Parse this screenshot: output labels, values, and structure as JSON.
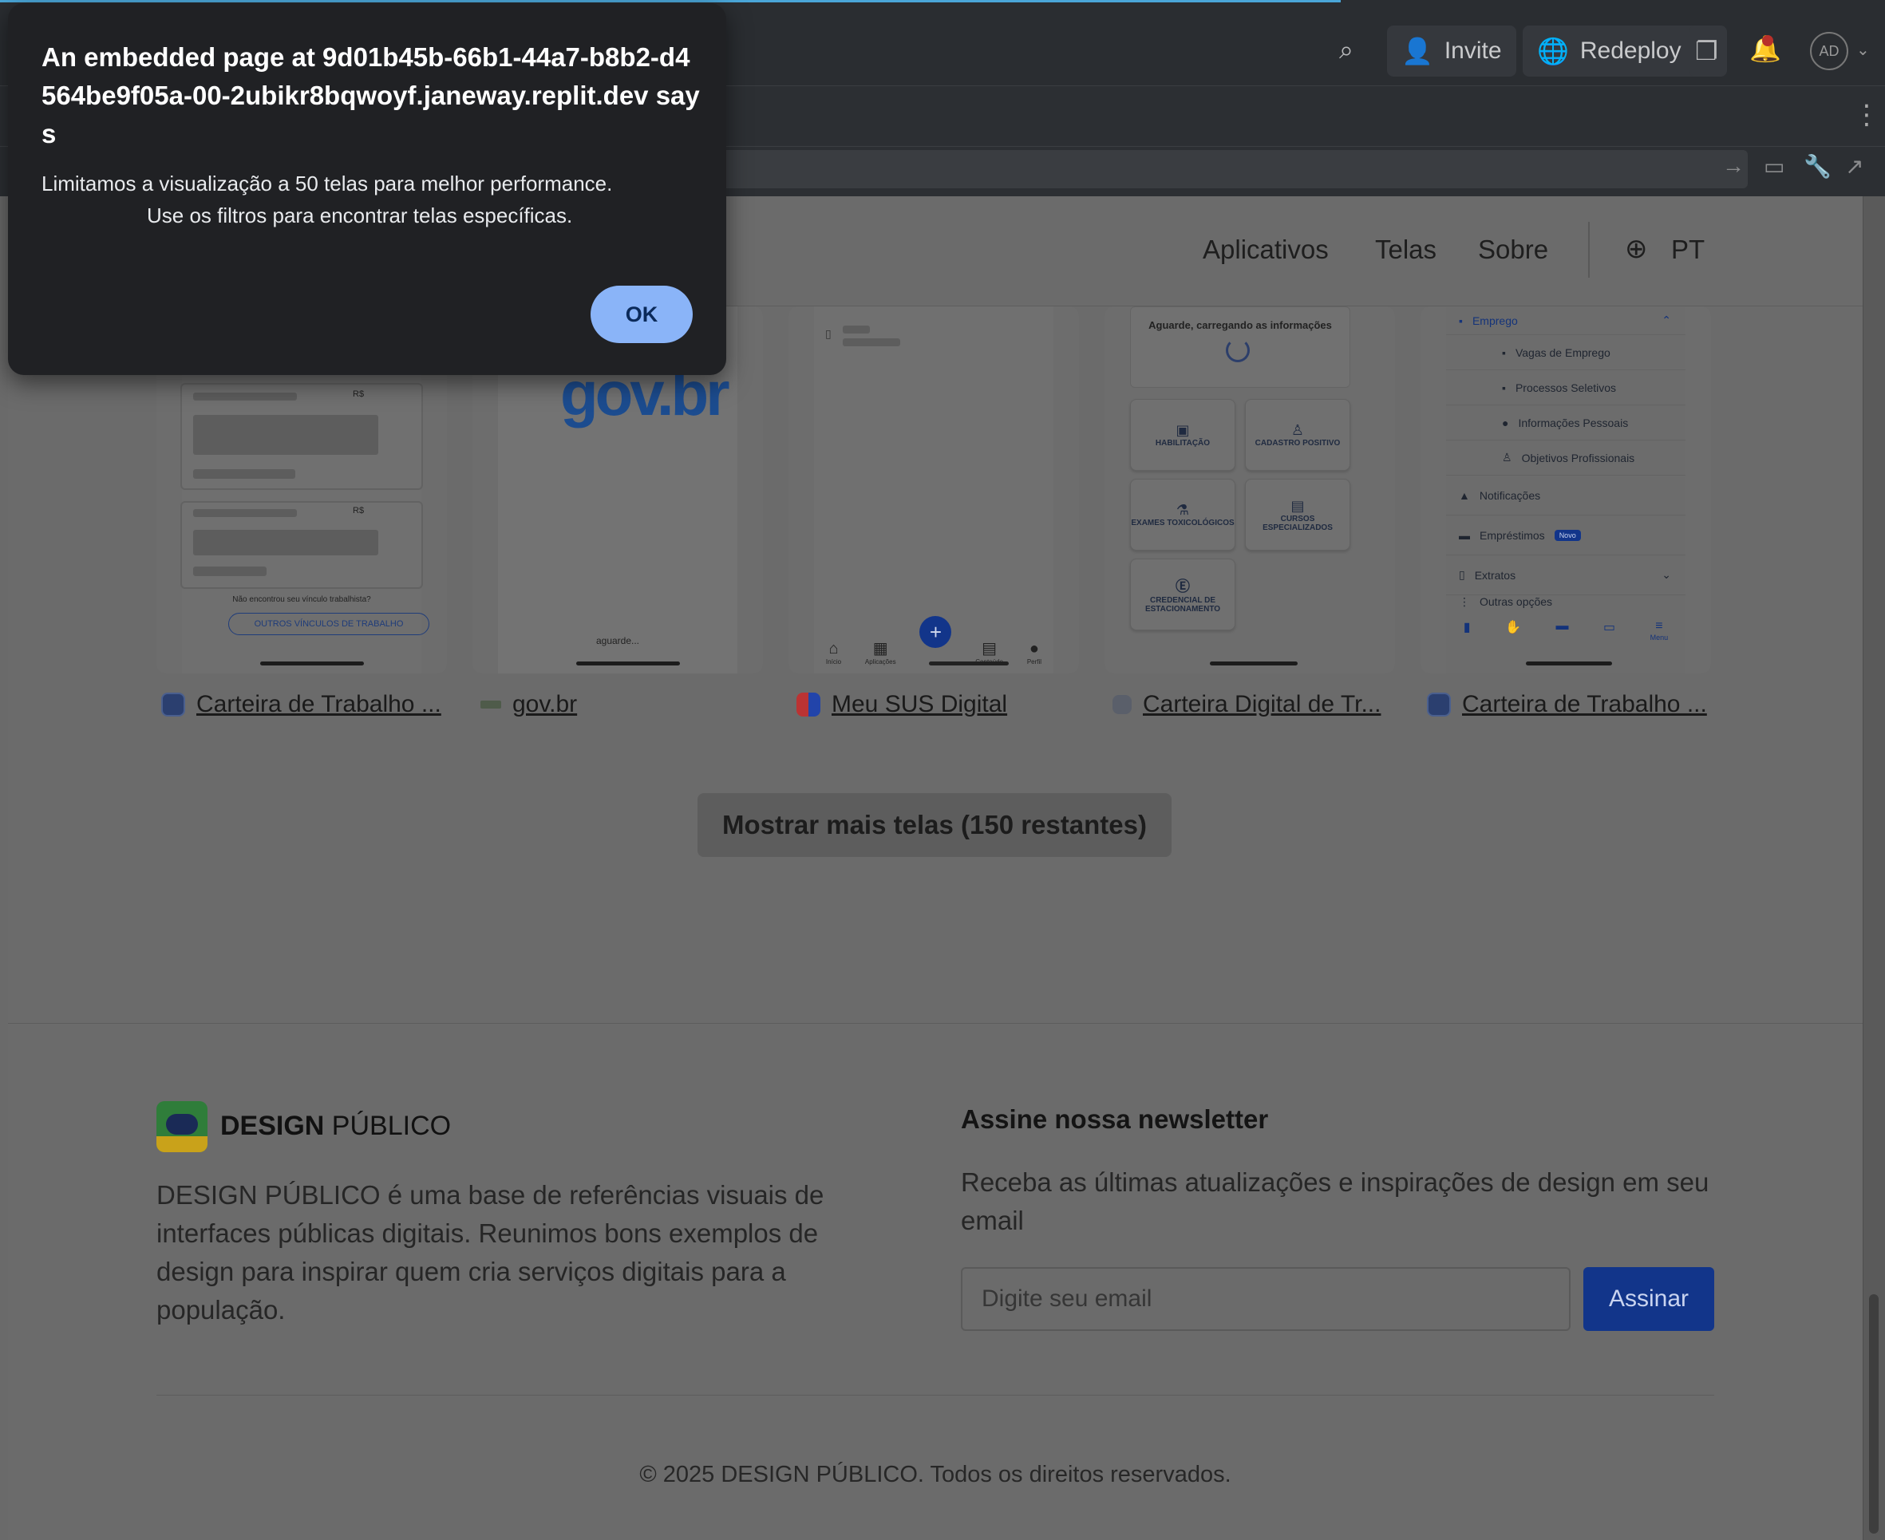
{
  "replit": {
    "invite_label": "Invite",
    "redeploy_label": "Redeploy",
    "avatar_initials": "AD"
  },
  "nav": {
    "apps": "Aplicativos",
    "screens": "Telas",
    "about": "Sobre",
    "lang": "PT"
  },
  "cards": [
    {
      "name": "Carteira de Trabalho ...",
      "no_link_text": "Não encontrou seu vínculo trabalhista?",
      "link_btn": "OUTROS VÍNCULOS DE TRABALHO",
      "currency": "R$"
    },
    {
      "name": "gov.br",
      "logo": "gov.br",
      "loading": "aguarde..."
    },
    {
      "name": "Meu SUS Digital",
      "tabs": [
        "Início",
        "Aplicações",
        "",
        "Conteúdo",
        "Perfil"
      ]
    },
    {
      "name": "Carteira Digital de Tr...",
      "loading": "Aguarde, carregando as informações",
      "tiles": [
        "HABILITAÇÃO",
        "CADASTRO POSITIVO",
        "EXAMES TOXICOLÓGICOS",
        "CURSOS ESPECIALIZADOS",
        "CREDENCIAL DE ESTACIONAMENTO"
      ]
    },
    {
      "name": "Carteira de Trabalho ...",
      "menu": [
        "Emprego",
        "Vagas de Emprego",
        "Processos Seletivos",
        "Informações Pessoais",
        "Objetivos Profissionais",
        "Notificações",
        "Empréstimos",
        "Extratos",
        "Outras opções"
      ],
      "badge": "Novo",
      "bottom_menu": "Menu"
    }
  ],
  "more_button": "Mostrar mais telas (150 restantes)",
  "footer": {
    "brand_bold": "DESIGN",
    "brand_rest": " PÚBLICO",
    "about": "DESIGN PÚBLICO é uma base de referências visuais de interfaces públicas digitais. Reunimos bons exemplos de design para inspirar quem cria serviços digitais para a população.",
    "newsletter_title": "Assine nossa newsletter",
    "newsletter_desc": "Receba as últimas atualizações e inspirações de design em seu email",
    "email_placeholder": "Digite seu email",
    "subscribe": "Assinar",
    "copyright": "© 2025 DESIGN PÚBLICO. Todos os direitos reservados."
  },
  "dialog": {
    "title": "An embedded page at 9d01b45b-66b1-44a7-b8b2-d4564be9f05a-00-2ubikr8bqwoyf.janeway.replit.dev says",
    "message_line1": "Limitamos a visualização a 50 telas para melhor performance.",
    "message_line2": "Use os filtros para encontrar telas específicas.",
    "ok": "OK"
  }
}
